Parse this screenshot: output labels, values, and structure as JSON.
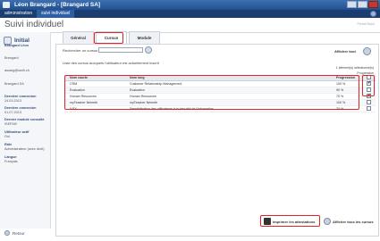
{
  "window": {
    "title": "Léon Brangard - [Brangard SA]"
  },
  "menu": {
    "tabs": [
      {
        "label": "administration"
      },
      {
        "label": "suivi individuel"
      }
    ]
  },
  "module": {
    "title": "Suivi individuel",
    "help": "Fiche/Suivi"
  },
  "sidebar": {
    "section_title": "Initial",
    "fields": [
      {
        "label": "Brangard Léon",
        "value": "Brangard"
      },
      {
        "label": "",
        "value": "assarg@swih.ch"
      },
      {
        "label": "",
        "value": "Brangard SA"
      },
      {
        "label": "Dernière connexion",
        "value": "24.03.2013"
      },
      {
        "label": "Dernière connexion",
        "value": "01.07.2013"
      },
      {
        "label": "Dernier module consulté",
        "value": "ISEFM9"
      },
      {
        "label": "Utilisateur actif",
        "value": "Oui"
      },
      {
        "label": "Rôle",
        "value": "Administrateur (avec droit)"
      },
      {
        "label": "Langue",
        "value": "Français"
      }
    ],
    "back_label": "Retour"
  },
  "tabs": [
    {
      "label": "Général"
    },
    {
      "label": "Cursus"
    },
    {
      "label": "Module"
    }
  ],
  "search": {
    "label": "Rechercher un cursus",
    "value": ""
  },
  "show_all_label": "Afficher tout",
  "list_description": "Liste des cursus auxquels l'utilisateur est actuellement inscrit",
  "selected_count": "1 élément(s) sélectionné(s)",
  "select_all_label": "Progression",
  "table": {
    "headers": [
      "Nom courte",
      "Nom long",
      "Progression"
    ],
    "rows": [
      {
        "short": "CRM",
        "long": "Customer Relationship Management",
        "progress": "100 %",
        "checked": true
      },
      {
        "short": "Evaluation",
        "long": "Evaluation",
        "progress": "90 %",
        "checked": false
      },
      {
        "short": "Human Resources",
        "long": "Human Resources",
        "progress": "70 %",
        "checked": true
      },
      {
        "short": "myTeacher Németh",
        "long": "myTeacher Németh",
        "progress": "100 %",
        "checked": false
      },
      {
        "short": "ILEX",
        "long": "Sensibilisation des utilisateurs à la sécurité de l'information",
        "progress": "30 %",
        "checked": false
      }
    ]
  },
  "footer": {
    "print_label": "Imprimer les attestations",
    "show_all_cursus_label": "Afficher tous les cursus"
  },
  "colors": {
    "highlight": "#e02424",
    "menubar": "#1b3d70"
  }
}
